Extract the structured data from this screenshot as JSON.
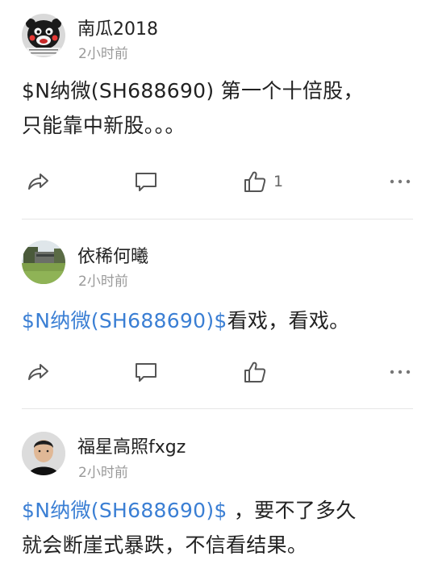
{
  "posts": [
    {
      "author": "南瓜2018",
      "time": "2小时前",
      "stock_link": "$N纳微(SH688690)",
      "body_line1_rest": " 第一个十倍股，",
      "body_line2": "只能靠中新股。。。",
      "like_count": "1"
    },
    {
      "author": "依稀何曦",
      "time": "2小时前",
      "stock_link": "$N纳微(SH688690)$",
      "body_rest": "看戏，看戏。",
      "like_count": ""
    },
    {
      "author": "福星高照fxgz",
      "time": "2小时前",
      "stock_link": "$N纳微(SH688690)$",
      "body_line1_rest": " ，要不了多久",
      "body_line2": "就会断崖式暴跌，不信看结果。"
    }
  ],
  "icons": {
    "share": "share-icon",
    "comment": "comment-icon",
    "like": "thumbs-up-icon",
    "more": "more-icon"
  },
  "colors": {
    "link": "#3b7fd4",
    "secondary_text": "#9a9a9a",
    "icon": "#555555",
    "divider": "#e6e6e6"
  }
}
